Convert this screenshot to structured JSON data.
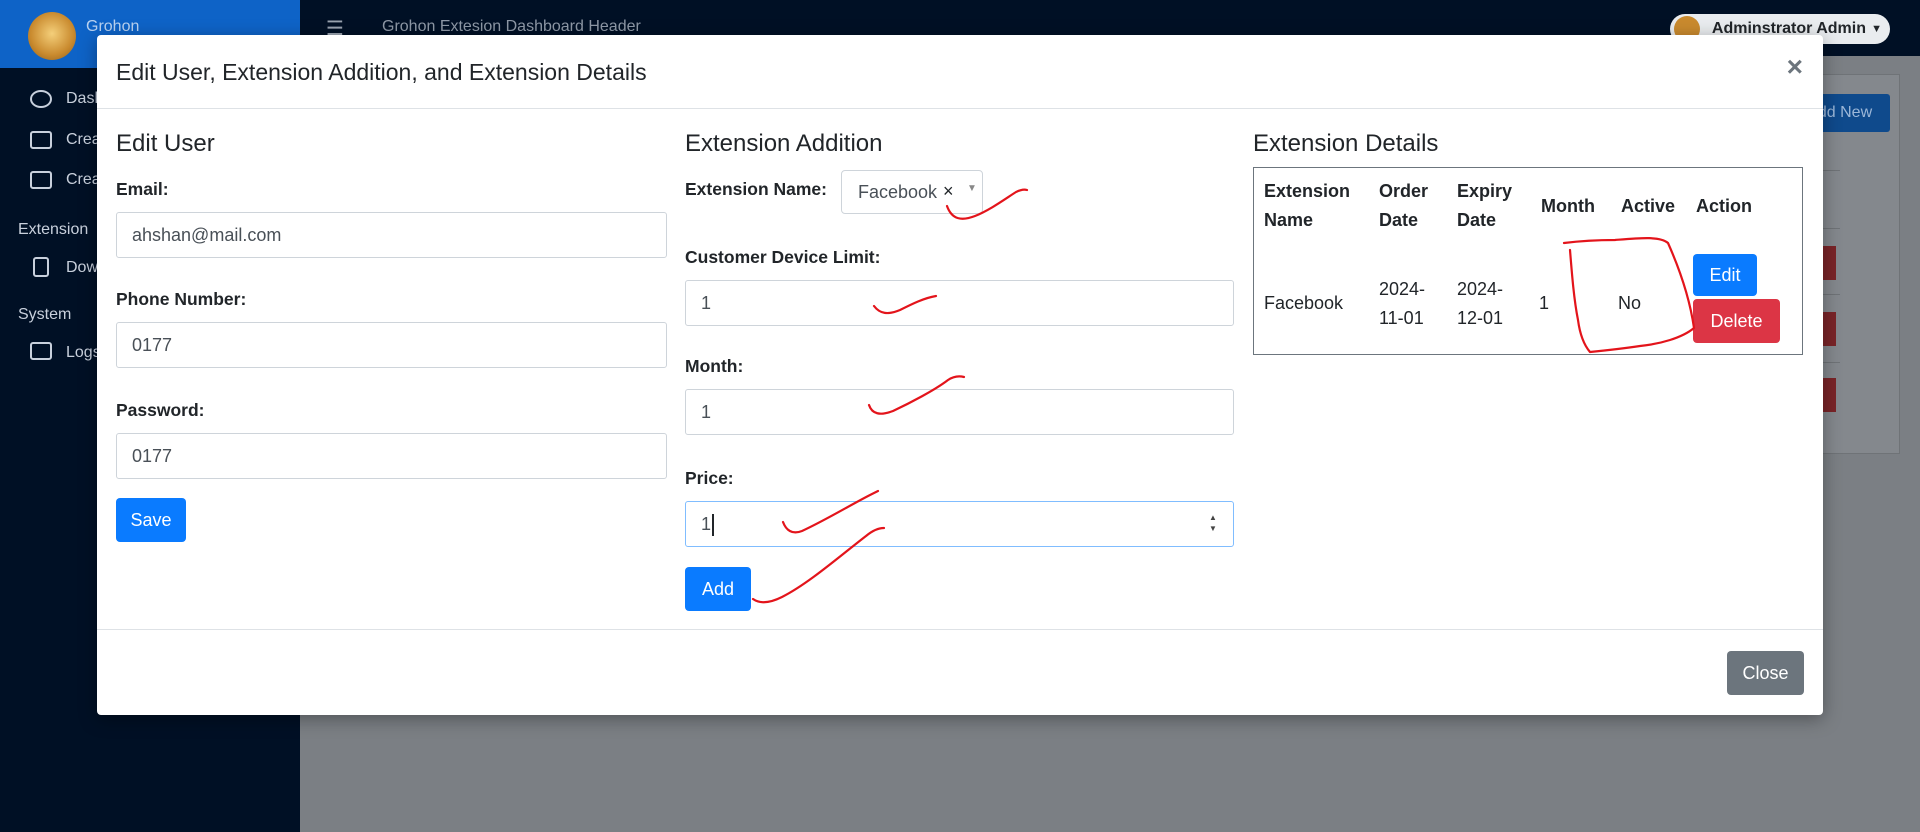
{
  "background": {
    "brand_name": "Grohon",
    "header_title": "Grohon Extesion Dashboard Header",
    "admin_name": "Adminstrator Admin",
    "nav": [
      {
        "label": "Dashb",
        "icon": "dashboard-icon"
      },
      {
        "label": "Creat",
        "icon": "wallet-icon"
      },
      {
        "label": "Creat",
        "icon": "wallet-icon"
      }
    ],
    "section_extension": "Extension",
    "nav_extension": [
      {
        "label": "Down",
        "icon": "file-icon"
      }
    ],
    "section_system": "System",
    "nav_system": [
      {
        "label": "Logs",
        "icon": "list-icon"
      }
    ],
    "add_new_label": "dd New"
  },
  "modal": {
    "title": "Edit User, Extension Addition, and Extension Details",
    "close_symbol": "×",
    "edit_user": {
      "heading": "Edit User",
      "email_label": "Email:",
      "email_value": "ahshan@mail.com",
      "phone_label": "Phone Number:",
      "phone_value": "0177",
      "password_label": "Password:",
      "password_value": "0177",
      "save_label": "Save"
    },
    "extension_addition": {
      "heading": "Extension Addition",
      "name_label": "Extension Name:",
      "name_value": "Facebook",
      "clear_symbol": "×",
      "device_limit_label": "Customer Device Limit:",
      "device_limit_value": "1",
      "month_label": "Month:",
      "month_value": "1",
      "price_label": "Price:",
      "price_value": "1",
      "add_label": "Add"
    },
    "extension_details": {
      "heading": "Extension Details",
      "columns": [
        "Extension Name",
        "Order Date",
        "Expiry Date",
        "Month",
        "Active",
        "Action"
      ],
      "rows": [
        {
          "name": "Facebook",
          "order_date": "2024-11-01",
          "expiry_date": "2024-12-01",
          "month": "1",
          "active": "No",
          "edit_label": "Edit",
          "delete_label": "Delete"
        }
      ]
    },
    "footer_close_label": "Close"
  },
  "colors": {
    "primary": "#0a7bff",
    "danger": "#dc3545",
    "secondary": "#6c757d",
    "sidebar": "#001025",
    "annotation": "#e3141b"
  }
}
